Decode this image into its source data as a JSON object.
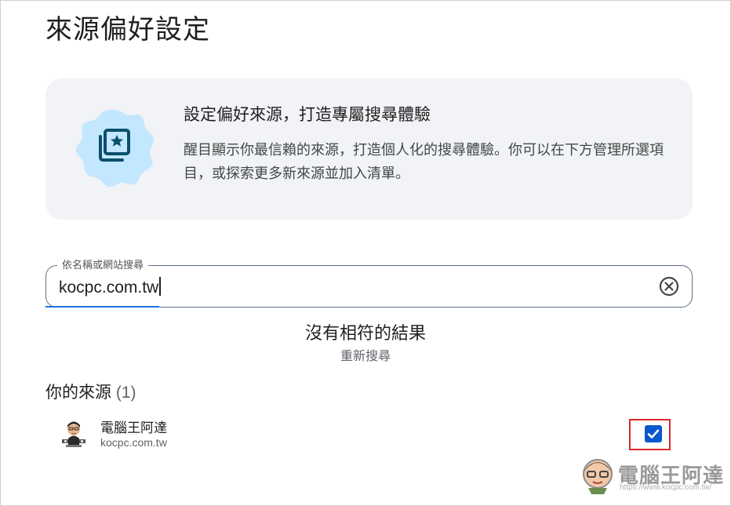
{
  "page": {
    "title": "來源偏好設定"
  },
  "info_card": {
    "title": "設定偏好來源，打造專屬搜尋體驗",
    "description": "醒目顯示你最信賴的來源，打造個人化的搜尋體驗。你可以在下方管理所選項目，或探索更多新來源並加入清單。",
    "icon": "star-photo-stack-icon"
  },
  "search": {
    "label": "依名稱或網站搜尋",
    "value": "kocpc.com.tw",
    "clear_icon": "clear-circle-icon"
  },
  "results": {
    "empty_message": "沒有相符的結果",
    "retry_label": "重新搜尋"
  },
  "your_sources": {
    "title": "你的來源",
    "count": "(1)",
    "items": [
      {
        "name": "電腦王阿達",
        "domain": "kocpc.com.tw",
        "checked": true
      }
    ]
  },
  "watermark": {
    "text": "電腦王阿達",
    "url": "https://www.kocpc.com.tw/"
  },
  "colors": {
    "accent": "#0b57d0",
    "card_bg": "#f1f3f6",
    "badge_bg": "#c2e7ff",
    "icon_color": "#0b4f6c",
    "highlight": "#e0282b"
  }
}
